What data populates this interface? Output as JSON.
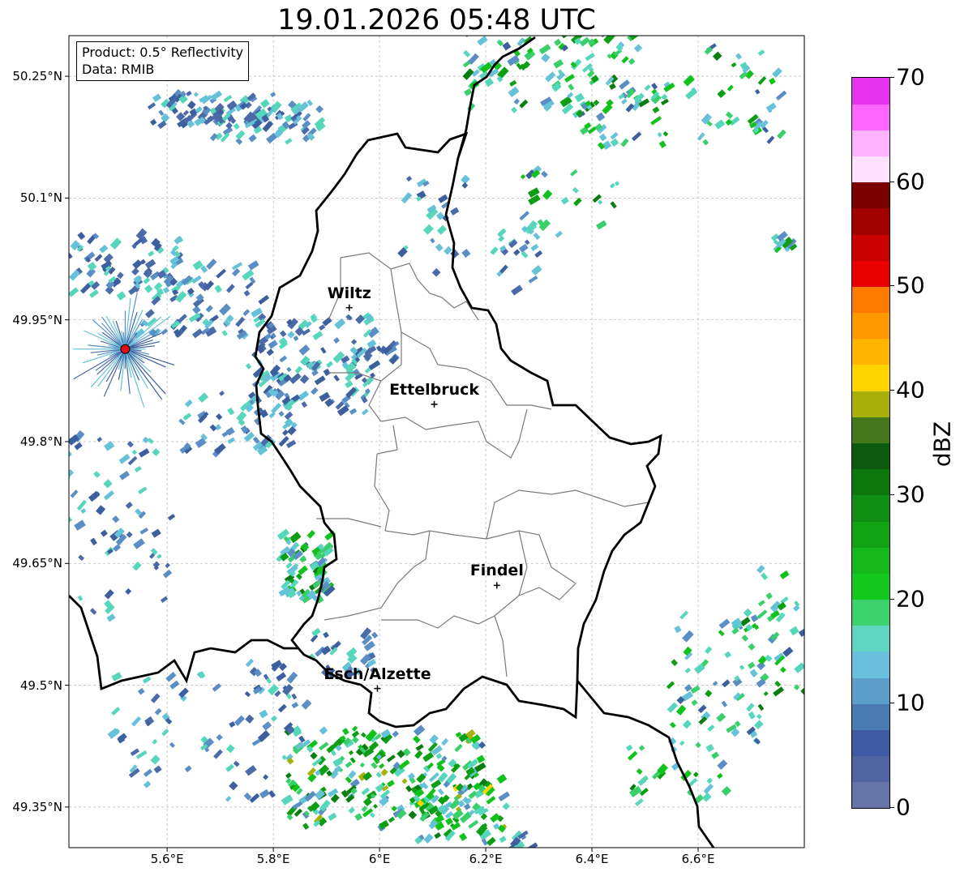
{
  "title": "19.01.2026 05:48 UTC",
  "infobox": {
    "product": "Product: 0.5° Reflectivity",
    "data": "Data: RMIB"
  },
  "extent": {
    "lon": [
      5.415,
      6.8
    ],
    "lat": [
      49.3,
      50.3
    ]
  },
  "latitude_ticks": [
    {
      "v": 50.25,
      "label": "50.25°N"
    },
    {
      "v": 50.1,
      "label": "50.1°N"
    },
    {
      "v": 49.95,
      "label": "49.95°N"
    },
    {
      "v": 49.8,
      "label": "49.8°N"
    },
    {
      "v": 49.65,
      "label": "49.65°N"
    },
    {
      "v": 49.5,
      "label": "49.5°N"
    },
    {
      "v": 49.35,
      "label": "49.35°N"
    }
  ],
  "longitude_ticks": [
    {
      "v": 5.6,
      "label": "5.6°E"
    },
    {
      "v": 5.8,
      "label": "5.8°E"
    },
    {
      "v": 6.0,
      "label": "6°E"
    },
    {
      "v": 6.2,
      "label": "6.2°E"
    },
    {
      "v": 6.4,
      "label": "6.4°E"
    },
    {
      "v": 6.6,
      "label": "6.6°E"
    }
  ],
  "cities": [
    {
      "name": "Wiltz",
      "lon": 5.943,
      "lat": 49.965
    },
    {
      "name": "Ettelbruck",
      "lon": 6.103,
      "lat": 49.846
    },
    {
      "name": "Findel",
      "lon": 6.221,
      "lat": 49.623
    },
    {
      "name": "Esch/Alzette",
      "lon": 5.996,
      "lat": 49.496
    }
  ],
  "radar_site": {
    "lon": 5.521,
    "lat": 49.914,
    "color": "#dd1111"
  },
  "colorbar": {
    "label": "dBZ",
    "min": 0,
    "max": 70,
    "step": 2.5,
    "ticks": [
      0,
      10,
      20,
      30,
      40,
      50,
      60,
      70
    ],
    "colors": [
      "#6674a8",
      "#4f64a0",
      "#3e5aa2",
      "#4a7ab2",
      "#5a9fca",
      "#68c0dc",
      "#5fd6c2",
      "#3cd36c",
      "#13c91e",
      "#14b818",
      "#12a314",
      "#0e8e12",
      "#0a780c",
      "#0c5a0e",
      "#45781a",
      "#a8b00a",
      "#ffd400",
      "#ffb400",
      "#ff9900",
      "#ff7a00",
      "#e80000",
      "#c80000",
      "#a00000",
      "#7a0000",
      "#ffe0ff",
      "#ffb2ff",
      "#ff66ff",
      "#e533f0"
    ]
  },
  "echo_palette": [
    "#4a6aa8",
    "#3d5f9e",
    "#5a8ec4",
    "#66c2d8",
    "#56d6bb",
    "#39cf6a",
    "#12c21c",
    "#0d9e14",
    "#0a7d10",
    "#a8b00a",
    "#ffd400"
  ]
}
